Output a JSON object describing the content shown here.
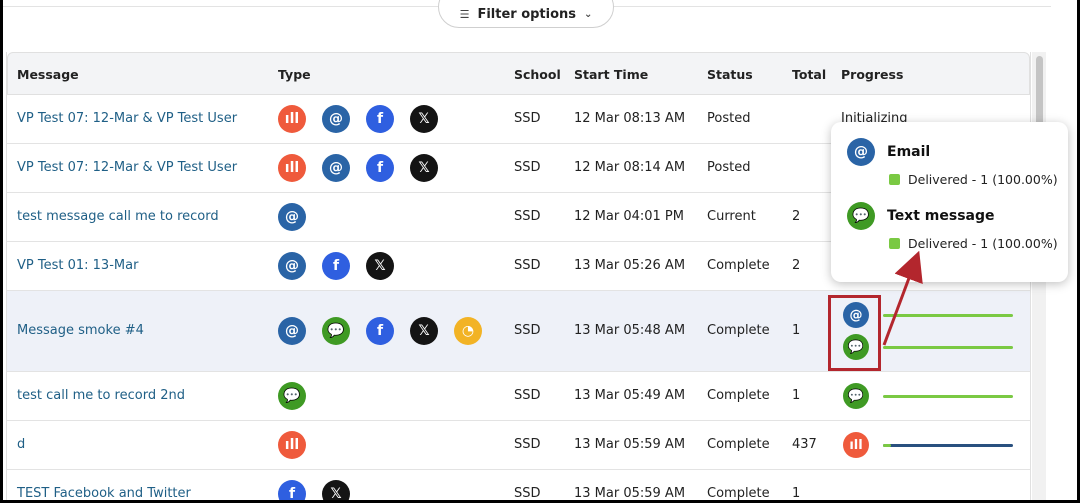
{
  "filter": {
    "label": "Filter options"
  },
  "columns": {
    "message": "Message",
    "type": "Type",
    "school": "School",
    "start_time": "Start Time",
    "status": "Status",
    "total": "Total",
    "progress": "Progress"
  },
  "rows": [
    {
      "message": "VP Test 07: 12-Mar & VP Test User",
      "types": [
        "voice-icon",
        "email-icon",
        "facebook-icon",
        "x-icon"
      ],
      "school": "SSD",
      "start": "12 Mar 08:13 AM",
      "status": "Posted",
      "total": "",
      "progress_text": "Initializing"
    },
    {
      "message": "VP Test 07: 12-Mar & VP Test User",
      "types": [
        "voice-icon",
        "email-icon",
        "facebook-icon",
        "x-icon"
      ],
      "school": "SSD",
      "start": "12 Mar 08:14 AM",
      "status": "Posted",
      "total": "",
      "progress_text": ""
    },
    {
      "message": "test message call me to record",
      "types": [
        "email-icon"
      ],
      "school": "SSD",
      "start": "12 Mar 04:01 PM",
      "status": "Current",
      "total": "2",
      "progress_text": ""
    },
    {
      "message": "VP Test 01: 13-Mar",
      "types": [
        "email-icon",
        "facebook-icon",
        "x-icon"
      ],
      "school": "SSD",
      "start": "13 Mar 05:26 AM",
      "status": "Complete",
      "total": "2",
      "progress_text": ""
    },
    {
      "message": "Message smoke #4",
      "types": [
        "email-icon",
        "sms-icon",
        "facebook-icon",
        "x-icon",
        "rss-icon"
      ],
      "school": "SSD",
      "start": "13 Mar 05:48 AM",
      "status": "Complete",
      "total": "1",
      "progress_text": ""
    },
    {
      "message": "test call me to record 2nd",
      "types": [
        "sms-icon"
      ],
      "school": "SSD",
      "start": "13 Mar 05:49 AM",
      "status": "Complete",
      "total": "1",
      "progress_text": ""
    },
    {
      "message": "d",
      "types": [
        "voice-icon"
      ],
      "school": "SSD",
      "start": "13 Mar 05:59 AM",
      "status": "Complete",
      "total": "437",
      "progress_text": ""
    },
    {
      "message": "TEST Facebook and Twitter",
      "types": [
        "facebook-icon",
        "x-icon"
      ],
      "school": "SSD",
      "start": "13 Mar 05:59 AM",
      "status": "Complete",
      "total": "1",
      "progress_text": ""
    }
  ],
  "progress": {
    "row5_email_fraction": 1.0,
    "row5_sms_fraction": 1.0,
    "row6_sms_fraction": 1.0,
    "row7_voice_fraction": 0.06
  },
  "popover": {
    "email_title": "Email",
    "email_line": "Delivered - 1 (100.00%)",
    "sms_title": "Text message",
    "sms_line": "Delivered - 1 (100.00%)"
  },
  "colors": {
    "voice": "#ef5a3c",
    "email": "#2a64a6",
    "facebook": "#2f5fe0",
    "x": "#141414",
    "sms": "#3f9a24",
    "rss": "#f2b325",
    "progress_green": "#7ac943",
    "progress_blue": "#29507f",
    "annotation_red": "#b3262d"
  }
}
